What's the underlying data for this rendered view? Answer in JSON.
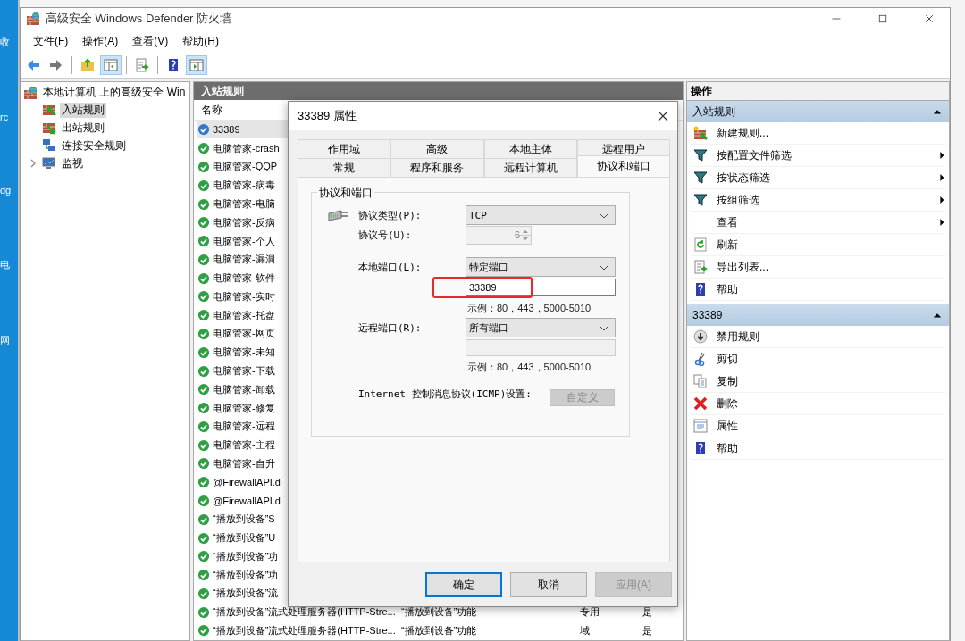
{
  "desktop": {
    "labels": [
      "收",
      "rc",
      "dg",
      "电",
      "网"
    ]
  },
  "window": {
    "title": "高级安全 Windows Defender 防火墙"
  },
  "menu": [
    "文件(F)",
    "操作(A)",
    "查看(V)",
    "帮助(H)"
  ],
  "toolbar": [
    {
      "kind": "back",
      "pressed": false
    },
    {
      "kind": "forward",
      "pressed": false
    },
    {
      "kind": "sep"
    },
    {
      "kind": "up",
      "pressed": false
    },
    {
      "kind": "tree",
      "pressed": true
    },
    {
      "kind": "sep"
    },
    {
      "kind": "export",
      "pressed": false
    },
    {
      "kind": "sep"
    },
    {
      "kind": "help",
      "pressed": false
    },
    {
      "kind": "pane",
      "pressed": true
    }
  ],
  "tree": {
    "label": "本地计算机 上的高级安全 Win",
    "children": [
      {
        "label": "入站规则",
        "selected": true
      },
      {
        "label": "出站规则",
        "selected": false
      },
      {
        "label": "连接安全规则",
        "selected": false
      },
      {
        "label": "监视",
        "selected": false,
        "expanded": false
      }
    ]
  },
  "rules": {
    "title": "入站规则",
    "columns": [
      "名称"
    ],
    "rows": [
      {
        "name": "33389",
        "kind": "custom",
        "selected": true
      },
      {
        "name": "电脑管家-crash",
        "kind": "allow",
        "selected": false
      },
      {
        "name": "电脑管家-QQP",
        "kind": "allow",
        "selected": false
      },
      {
        "name": "电脑管家-病毒",
        "kind": "allow",
        "selected": false
      },
      {
        "name": "电脑管家-电脑",
        "kind": "allow",
        "selected": false
      },
      {
        "name": "电脑管家-反病",
        "kind": "allow",
        "selected": false
      },
      {
        "name": "电脑管家-个人",
        "kind": "allow",
        "selected": false
      },
      {
        "name": "电脑管家-漏洞",
        "kind": "allow",
        "selected": false
      },
      {
        "name": "电脑管家-软件",
        "kind": "allow",
        "selected": false
      },
      {
        "name": "电脑管家-实时",
        "kind": "allow",
        "selected": false
      },
      {
        "name": "电脑管家-托盘",
        "kind": "allow",
        "selected": false
      },
      {
        "name": "电脑管家-网页",
        "kind": "allow",
        "selected": false
      },
      {
        "name": "电脑管家-未知",
        "kind": "allow",
        "selected": false
      },
      {
        "name": "电脑管家-下载",
        "kind": "allow",
        "selected": false
      },
      {
        "name": "电脑管家-卸载",
        "kind": "allow",
        "selected": false
      },
      {
        "name": "电脑管家-修复",
        "kind": "allow",
        "selected": false
      },
      {
        "name": "电脑管家-远程",
        "kind": "allow",
        "selected": false
      },
      {
        "name": "电脑管家-主程",
        "kind": "allow",
        "selected": false
      },
      {
        "name": "电脑管家-自升",
        "kind": "allow",
        "selected": false
      },
      {
        "name": "@FirewallAPI.d",
        "kind": "allow",
        "selected": false
      },
      {
        "name": "@FirewallAPI.d",
        "kind": "allow",
        "selected": false
      },
      {
        "name": "“播放到设备”S",
        "kind": "allow",
        "selected": false
      },
      {
        "name": "“播放到设备”U",
        "kind": "allow",
        "selected": false
      },
      {
        "name": "“播放到设备”功",
        "kind": "allow",
        "selected": false
      },
      {
        "name": "“播放到设备”功",
        "kind": "allow",
        "selected": false
      },
      {
        "name": "“播放到设备”流",
        "kind": "allow",
        "selected": false
      },
      {
        "name": "“播放到设备”流式处理服务器(HTTP-Stre...",
        "kind": "allow",
        "selected": false,
        "cells": [
          "“播放到设备”功能",
          "专用",
          "是"
        ]
      },
      {
        "name": "“播放到设备”流式处理服务器(HTTP-Stre...",
        "kind": "allow",
        "selected": false,
        "cells": [
          "“播放到设备”功能",
          "域",
          "是"
        ]
      }
    ]
  },
  "actions": {
    "title": "操作",
    "sections": [
      {
        "title": "入站规则",
        "expanded": true,
        "items": [
          {
            "label": "新建规则...",
            "submenu": false
          },
          {
            "label": "按配置文件筛选",
            "submenu": true
          },
          {
            "label": "按状态筛选",
            "submenu": true
          },
          {
            "label": "按组筛选",
            "submenu": true
          },
          {
            "label": "查看",
            "submenu": true
          },
          {
            "label": "刷新",
            "submenu": false
          },
          {
            "label": "导出列表...",
            "submenu": false
          },
          {
            "label": "帮助",
            "submenu": false
          }
        ]
      },
      {
        "title": "33389",
        "expanded": true,
        "items": [
          {
            "label": "禁用规则",
            "submenu": false
          },
          {
            "label": "剪切",
            "submenu": false
          },
          {
            "label": "复制",
            "submenu": false
          },
          {
            "label": "删除",
            "submenu": false
          },
          {
            "label": "属性",
            "submenu": false
          },
          {
            "label": "帮助",
            "submenu": false
          }
        ]
      }
    ]
  },
  "dialog": {
    "title": "33389 属性",
    "tab_rows": [
      [
        {
          "label": "作用域",
          "selected": false
        },
        {
          "label": "高级",
          "selected": false
        },
        {
          "label": "本地主体",
          "selected": false
        },
        {
          "label": "远程用户",
          "selected": false
        }
      ],
      [
        {
          "label": "常规",
          "selected": false
        },
        {
          "label": "程序和服务",
          "selected": false
        },
        {
          "label": "远程计算机",
          "selected": false
        },
        {
          "label": "协议和端口",
          "selected": true
        }
      ]
    ],
    "group": {
      "title": "协议和端口",
      "protocol_type": {
        "label": "协议类型(P):",
        "value": "TCP"
      },
      "protocol_number": {
        "label": "协议号(U):",
        "value": "6",
        "disabled": true
      },
      "local_port": {
        "label": "本地端口(L):",
        "value": "特定端口",
        "ports": "33389",
        "highlighted": true,
        "example": "示例：80，443，5000-5010"
      },
      "remote_port": {
        "label": "远程端口(R):",
        "value": "所有端口",
        "ports_disabled": true,
        "example": "示例：80，443，5000-5010"
      },
      "icmp": {
        "label": "Internet 控制消息协议(ICMP)设置:",
        "button": "自定义",
        "button_disabled": true
      }
    },
    "buttons": [
      {
        "label": "确定",
        "default": true,
        "disabled": false
      },
      {
        "label": "取消",
        "default": false,
        "disabled": false
      },
      {
        "label": "应用(A)",
        "default": false,
        "disabled": true
      }
    ]
  }
}
